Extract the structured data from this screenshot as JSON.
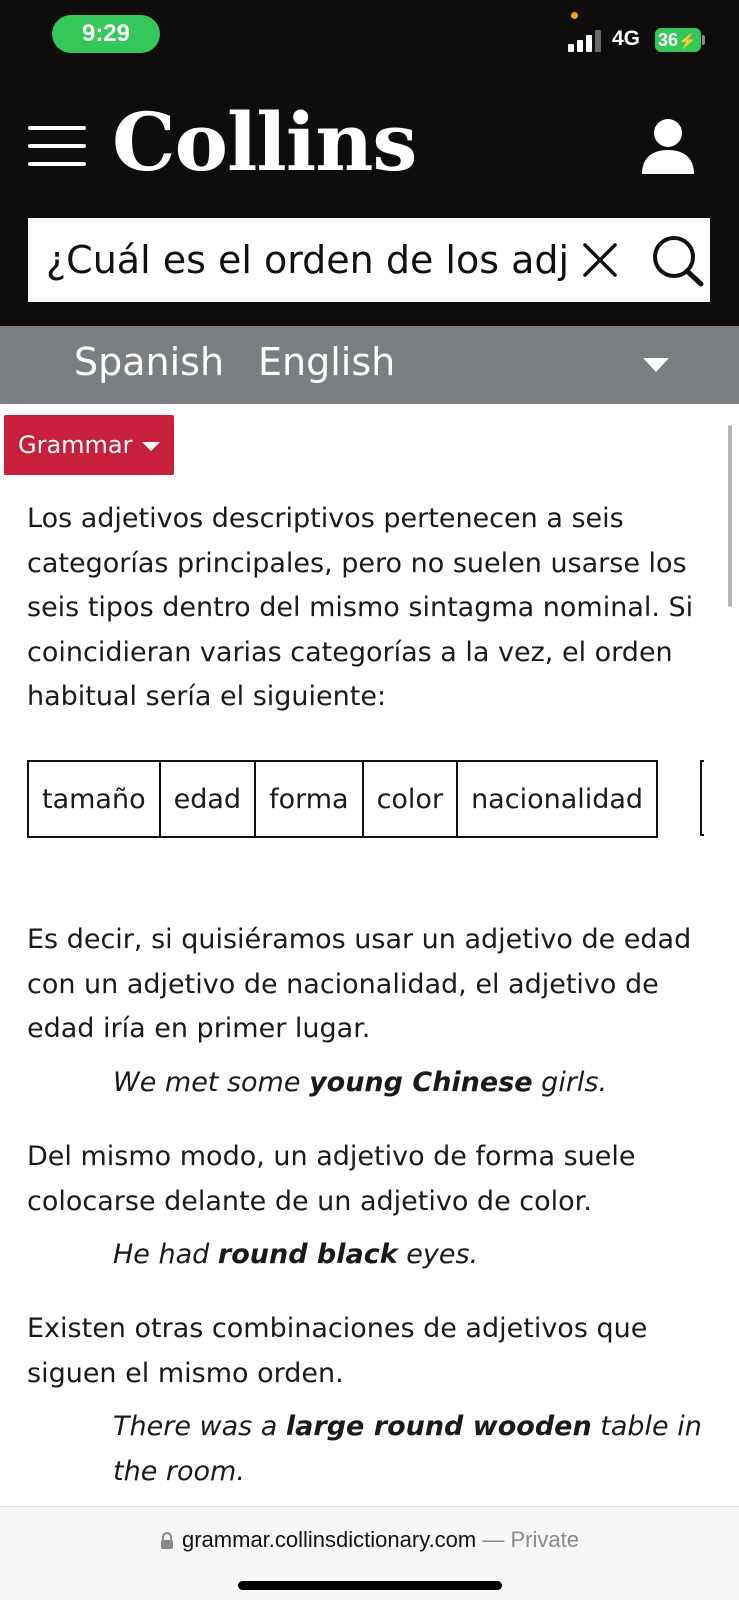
{
  "status_bar": {
    "time": "9:29",
    "network": "4G",
    "battery": "36"
  },
  "header": {
    "logo": "Collins",
    "search": {
      "value": "¿Cuál es el orden de los adj"
    }
  },
  "language_bar": {
    "languages": [
      "Spanish",
      "English"
    ]
  },
  "grammar_button": {
    "label": "Grammar"
  },
  "content": {
    "para1": "Los adjetivos descriptivos pertenecen a seis categorías principales, pero no suelen usarse los seis tipos dentro del mismo sintagma nominal. Si coincidieran varias categorías a la vez, el orden habitual sería el siguiente:",
    "order_table": [
      "tamaño",
      "edad",
      "forma",
      "color",
      "nacionalidad"
    ],
    "para2": "Es decir, si quisiéramos usar un adjetivo de edad con un adjetivo de nacionalidad, el adjetivo de edad iría en primer lugar.",
    "example1": {
      "pre": "We met some ",
      "bold": "young Chinese",
      "post": " girls."
    },
    "para3": "Del mismo modo, un adjetivo de forma suele colocarse delante de un adjetivo de color.",
    "example2": {
      "pre": "He had ",
      "bold": "round black",
      "post": " eyes."
    },
    "para4": "Existen otras combinaciones de adjetivos que siguen el mismo orden.",
    "example3": {
      "pre": "There was a ",
      "bold": "large round wooden",
      "post": " table in the room."
    }
  },
  "url_bar": {
    "domain": "grammar.collinsdictionary.com",
    "separator": "—",
    "mode": "Private"
  },
  "colors": {
    "header_bg": "#0f0d0b",
    "lang_bar_bg": "#7b7e81",
    "grammar_red": "#c8203b",
    "status_green": "#34c759"
  }
}
